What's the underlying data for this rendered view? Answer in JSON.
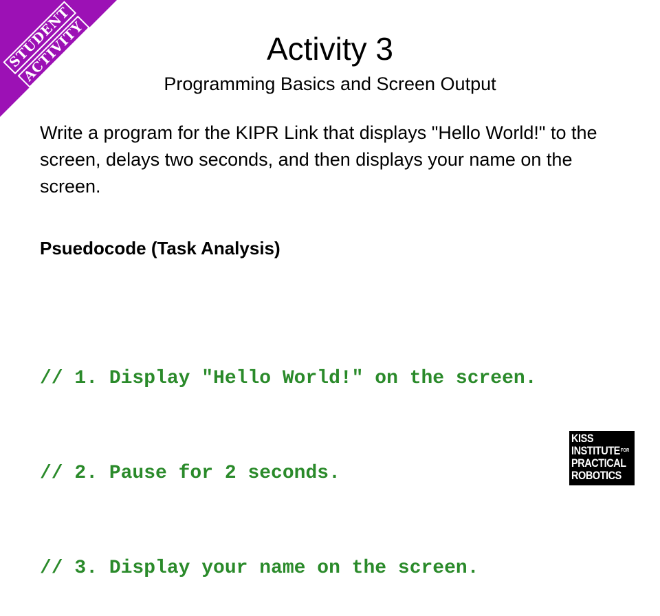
{
  "badge": {
    "line1": "STUDENT",
    "line2": "ACTIVITY",
    "color": "#9c11b5"
  },
  "slide": {
    "title": "Activity 3",
    "subtitle": "Programming Basics and Screen Output",
    "body": "Write a program for the KIPR Link that displays \"Hello World!\" to the screen, delays two seconds, and then displays your name on the screen.",
    "section_heading": "Psuedocode (Task Analysis)",
    "pseudocode_color": "#2a8a2a",
    "pseudocode": [
      "// 1. Display \"Hello World!\" on the screen.",
      "// 2. Pause for 2 seconds.",
      "// 3. Display your name on the screen."
    ]
  },
  "logo": {
    "line1": "KISS",
    "line2": "INSTITUTE",
    "line2_sup": "FOR",
    "line3": "PRACTICAL",
    "line4": "ROBOTICS"
  }
}
